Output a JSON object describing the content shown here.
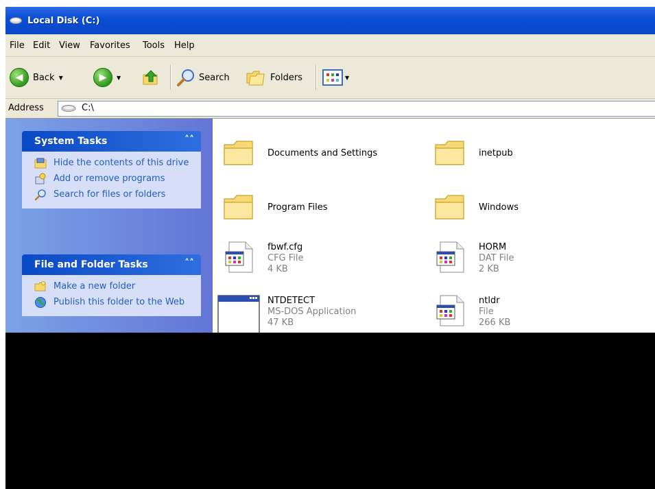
{
  "window": {
    "title": "Local Disk (C:)"
  },
  "menu": [
    "File",
    "Edit",
    "View",
    "Favorites",
    "Tools",
    "Help"
  ],
  "toolbar": {
    "back_label": "Back",
    "search_label": "Search",
    "folders_label": "Folders"
  },
  "address": {
    "label": "Address",
    "value": "C:\\"
  },
  "system_tasks": {
    "title": "System Tasks",
    "items": [
      {
        "label": "Hide the contents of this drive",
        "icon": "hide-contents-icon"
      },
      {
        "label": "Add or remove programs",
        "icon": "add-remove-programs-icon"
      },
      {
        "label": "Search for files or folders",
        "icon": "search-icon"
      }
    ]
  },
  "file_folder_tasks": {
    "title": "File and Folder Tasks",
    "items": [
      {
        "label": "Make a new folder",
        "icon": "new-folder-icon"
      },
      {
        "label": "Publish this folder to the Web",
        "icon": "publish-web-icon"
      }
    ]
  },
  "items": [
    {
      "name": "Documents and Settings",
      "type": "",
      "size": "",
      "icon": "folder-icon"
    },
    {
      "name": "inetpub",
      "type": "",
      "size": "",
      "icon": "folder-icon"
    },
    {
      "name": "Program Files",
      "type": "",
      "size": "",
      "icon": "folder-icon"
    },
    {
      "name": "Windows",
      "type": "",
      "size": "",
      "icon": "folder-icon"
    },
    {
      "name": "fbwf.cfg",
      "type": "CFG File",
      "size": "4 KB",
      "icon": "file-icon"
    },
    {
      "name": "HORM",
      "type": "DAT File",
      "size": "2 KB",
      "icon": "file-icon"
    },
    {
      "name": "NTDETECT",
      "type": "MS-DOS Application",
      "size": "47 KB",
      "icon": "application-icon"
    },
    {
      "name": "ntldr",
      "type": "File",
      "size": "266 KB",
      "icon": "file-icon"
    }
  ]
}
